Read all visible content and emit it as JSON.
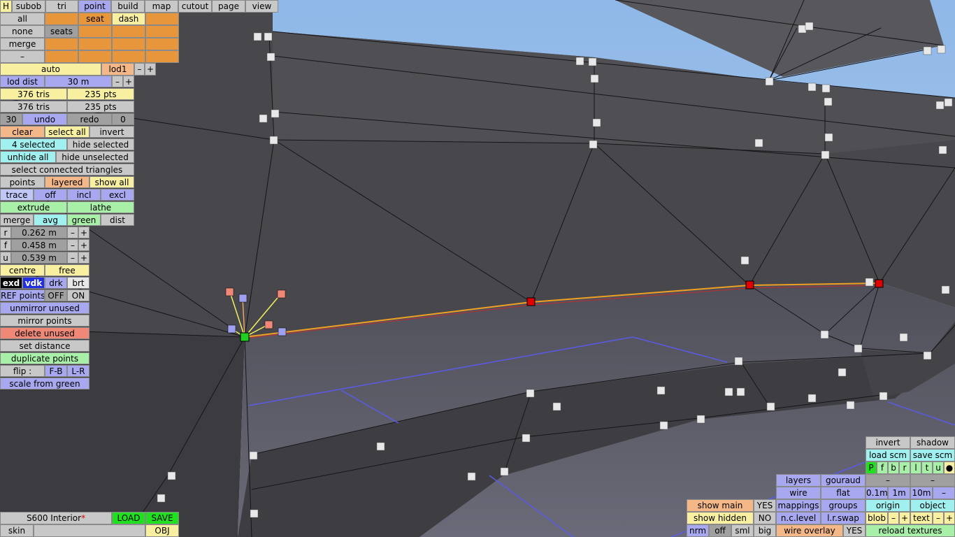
{
  "toolbar": {
    "tabs": [
      "H",
      "subob",
      "tri",
      "point",
      "build",
      "map",
      "cutout",
      "page",
      "view"
    ],
    "active_tab": "point"
  },
  "sel_row1": {
    "all": "all",
    "seat": "seat",
    "dash": "dash"
  },
  "sel_row2": {
    "none": "none",
    "seats": "seats"
  },
  "sel_row3": {
    "merge": "merge"
  },
  "sel_row4": {
    "minus": "–"
  },
  "lod": {
    "auto": "auto",
    "lod1": "lod1",
    "minus": "–",
    "plus": "+",
    "dist_label": "lod dist",
    "dist_value": "30 m"
  },
  "stats": {
    "tris1": "376 tris",
    "pts1": "235 pts",
    "tris2": "376 tris",
    "pts2": "235 pts"
  },
  "history": {
    "undo_count": "30",
    "undo": "undo",
    "redo": "redo",
    "redo_count": "0"
  },
  "selection": {
    "clear": "clear",
    "select_all": "select all",
    "invert": "invert",
    "selected": "4 selected",
    "hide_selected": "hide selected",
    "unhide_all": "unhide all",
    "hide_unselected": "hide unselected",
    "select_connected": "select connected triangles"
  },
  "points_row": {
    "points": "points",
    "layered": "layered",
    "show_all": "show all"
  },
  "trace": {
    "trace": "trace",
    "off": "off",
    "incl": "incl",
    "excl": "excl"
  },
  "extrude": {
    "extrude": "extrude",
    "lathe": "lathe"
  },
  "merge_row": {
    "merge": "merge",
    "avg": "avg",
    "green": "green",
    "dist": "dist"
  },
  "coords": [
    {
      "axis": "r",
      "value": "0.262 m"
    },
    {
      "axis": "f",
      "value": "0.458 m"
    },
    {
      "axis": "u",
      "value": "0.539 m"
    }
  ],
  "step": {
    "minus": "–",
    "plus": "+"
  },
  "pivot": {
    "centre": "centre",
    "free": "free"
  },
  "display": {
    "exd": "exd",
    "vdk": "vdk",
    "drk": "drk",
    "brt": "brt"
  },
  "ref": {
    "label": "REF points",
    "off": "OFF",
    "on": "ON"
  },
  "actions": {
    "unmirror": "unmirror unused",
    "mirror": "mirror points",
    "delete": "delete unused",
    "set_distance": "set distance",
    "duplicate": "duplicate points",
    "flip": "flip :",
    "fb": "F-B",
    "lr": "L-R",
    "scale": "scale from green"
  },
  "file": {
    "name": "S600 Interior",
    "modified_mark": "*",
    "load": "LOAD",
    "save": "SAVE",
    "skin": "skin",
    "obj": "OBJ"
  },
  "render": {
    "invert": "invert",
    "shadow": "shadow",
    "load_scm": "load scm",
    "save_scm": "save scm",
    "channels": [
      "P",
      "f",
      "b",
      "r",
      "l",
      "t",
      "u",
      "●"
    ],
    "layers": "layers",
    "gouraud": "gouraud",
    "wire": "wire",
    "flat": "flat",
    "d01": "0.1m",
    "d1": "1m",
    "d10": "10m",
    "dminus": "–",
    "mappings": "mappings",
    "groups": "groups",
    "origin": "origin",
    "object": "object",
    "nclevel": "n.c.level",
    "lrswap": "l.r.swap",
    "blob": "blob",
    "text": "text",
    "minus": "–",
    "plus": "+",
    "show_main": "show main",
    "yes1": "YES",
    "show_hidden": "show hidden",
    "no1": "NO",
    "nrm": "nrm",
    "off": "off",
    "sml": "sml",
    "big": "big",
    "wire_overlay": "wire overlay",
    "yes2": "YES",
    "reload": "reload textures"
  },
  "colors": {
    "sky": "#a9c4e4",
    "mesh": "#46464a",
    "selected_edge": "#f0a020",
    "red_point": "#e00000",
    "green_point": "#20d020"
  }
}
